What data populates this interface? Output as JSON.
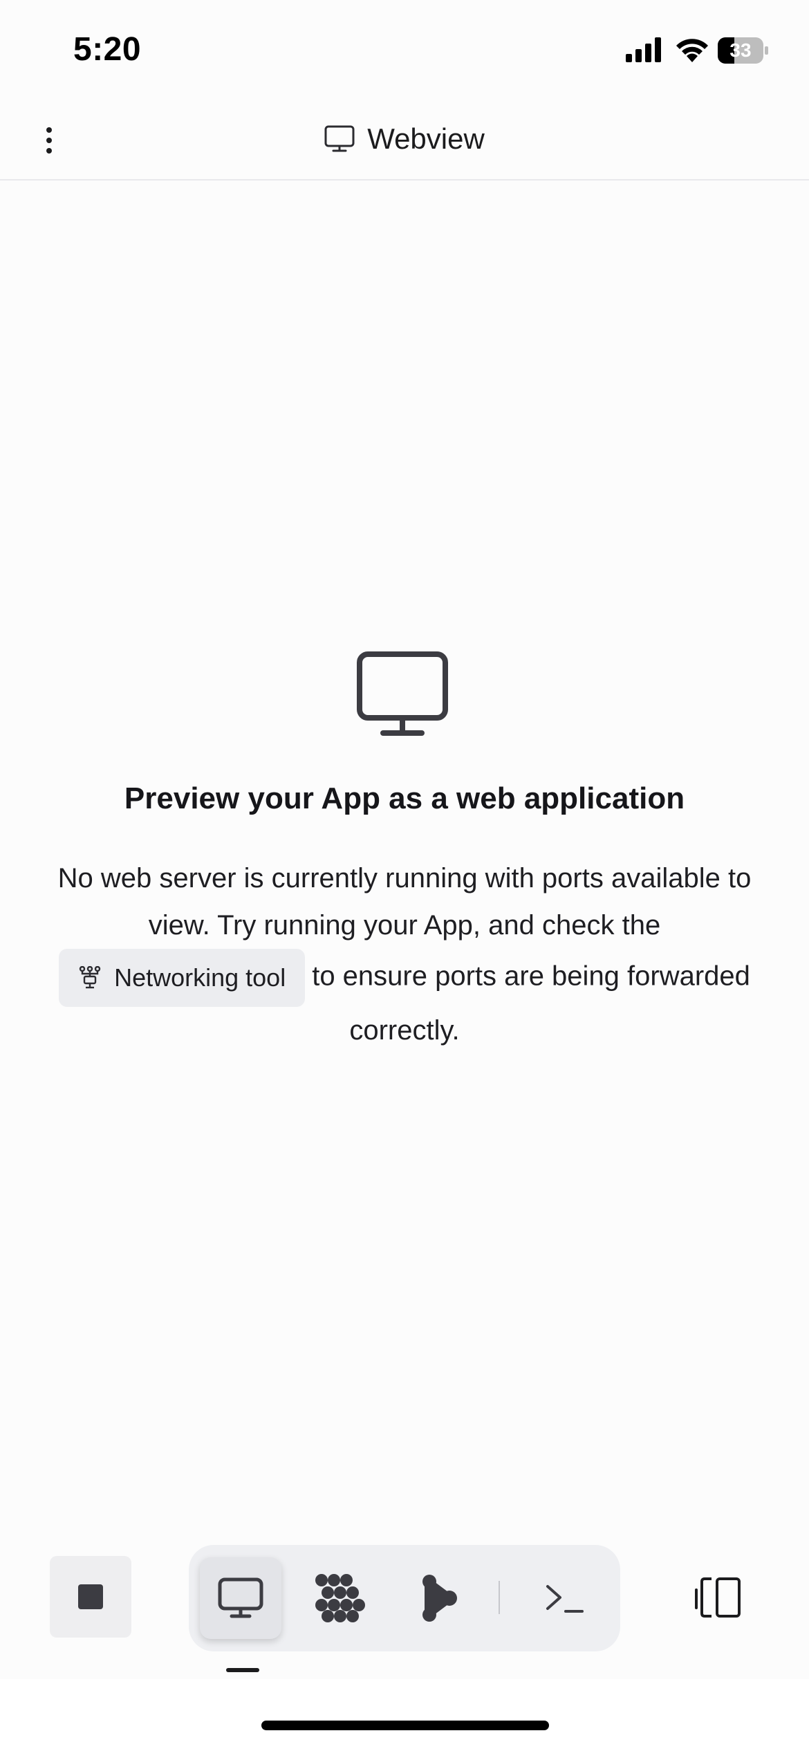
{
  "status_bar": {
    "time": "5:20",
    "battery_level": "33",
    "icons": [
      "cellular-signal-icon",
      "wifi-icon",
      "battery-icon"
    ]
  },
  "header": {
    "menu_icon": "kebab-menu-icon",
    "title_icon": "monitor-icon",
    "title": "Webview"
  },
  "empty_state": {
    "icon": "monitor-icon",
    "title": "Preview your App as a web application",
    "description_before": "No web server is currently running with ports available to view. Try running your App, and check the",
    "networking_tool_icon": "network-icon",
    "networking_tool_label": "Networking tool",
    "description_after": "to ensure ports are being forwarded correctly."
  },
  "toolbar": {
    "stop_icon": "stop-icon",
    "tools": [
      {
        "icon": "monitor-icon",
        "active": true
      },
      {
        "icon": "dots-grid-icon",
        "active": false
      },
      {
        "icon": "git-branch-icon",
        "active": false
      },
      {
        "icon": "terminal-icon",
        "active": false
      }
    ],
    "panel_toggle_icon": "panel-toggle-icon"
  },
  "colors": {
    "background": "#fcfcfc",
    "text": "#1b1b1d",
    "chip_background": "#ecedf0",
    "toolbar_group": "#eeeff2",
    "icon": "#3c3c42"
  }
}
